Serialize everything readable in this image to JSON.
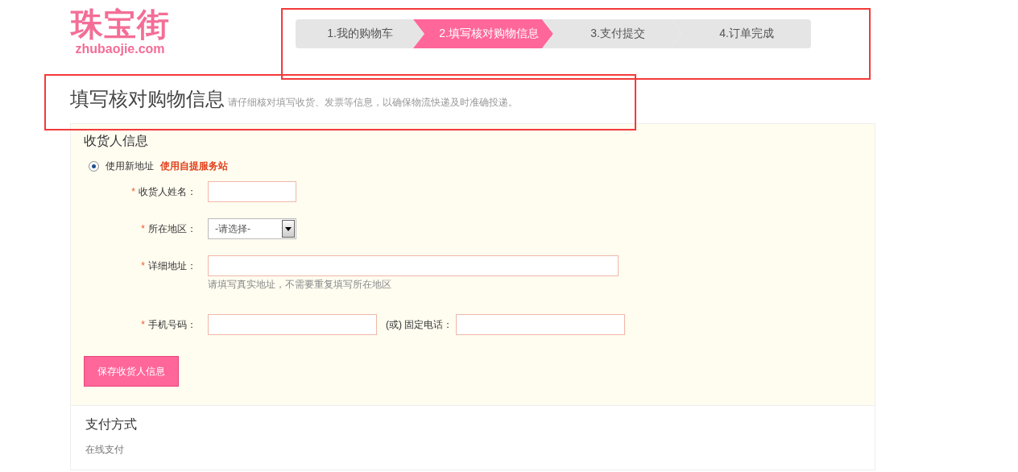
{
  "logo": {
    "name": "珠宝街",
    "domain": "zhubaojie.com"
  },
  "steps": [
    {
      "label": "1.我的购物车",
      "selected": false
    },
    {
      "label": "2.填写核对购物信息",
      "selected": true
    },
    {
      "label": "3.支付提交",
      "selected": false
    },
    {
      "label": "4.订单完成",
      "selected": false
    }
  ],
  "page_title": "填写核对购物信息",
  "page_subtitle": "请仔细核对填写收货、发票等信息，以确保物流快递及时准确投递。",
  "receiver": {
    "title": "收货人信息",
    "address_choice": {
      "label": "使用新地址",
      "selected": true
    },
    "pickup_link": "使用自提服务站",
    "fields": [
      {
        "kind": "short_text",
        "marker": "*",
        "label": "收货人姓名："
      },
      {
        "kind": "select",
        "marker": "*",
        "label": "所在地区：",
        "value": "-请选择-"
      },
      {
        "kind": "long_text",
        "marker": "*",
        "label": "详细地址：",
        "hint": "请填写真实地址，不需要重复填写所在地区"
      },
      {
        "kind": "phone",
        "marker": "*",
        "label": "手机号码：",
        "secondary_label": "(或) 固定电话："
      }
    ],
    "save_button": "保存收货人信息"
  },
  "payment": {
    "title": "支付方式",
    "method": "在线支付"
  }
}
